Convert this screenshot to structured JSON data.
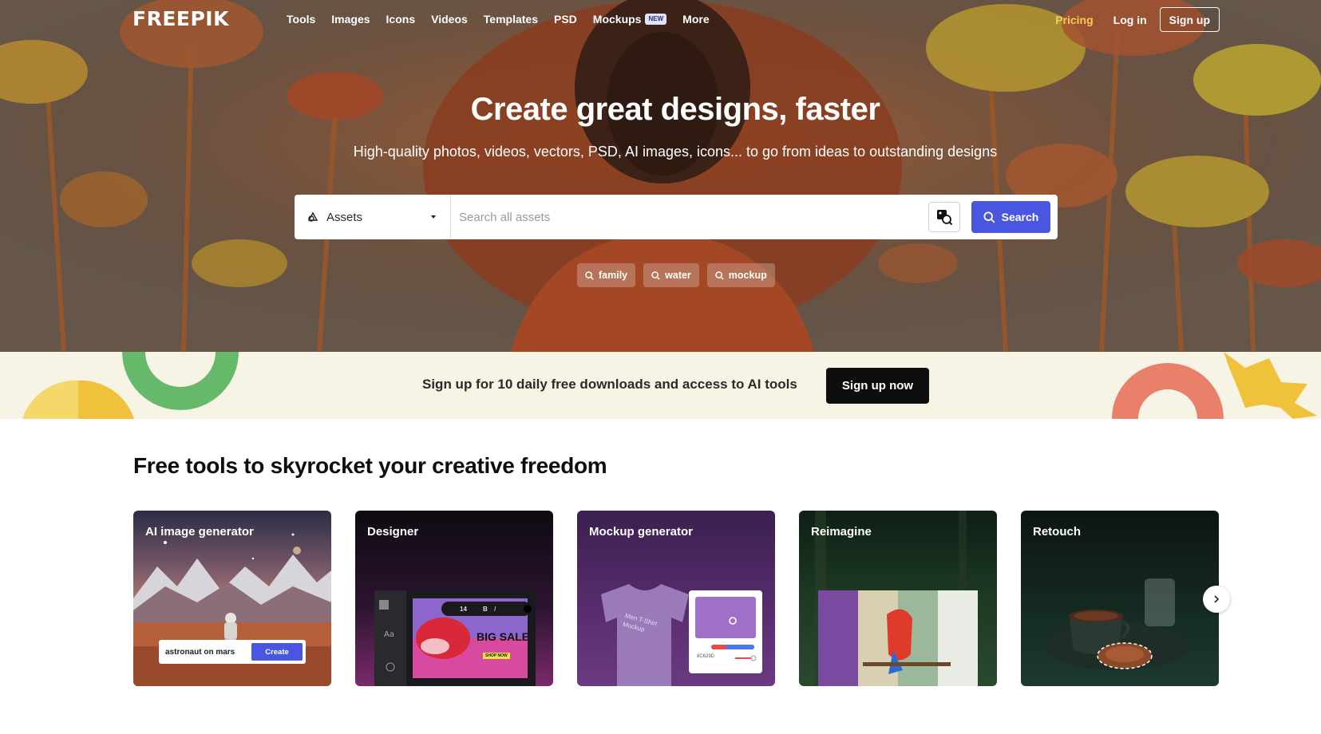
{
  "nav": {
    "logo": "FREEPIK",
    "links": [
      {
        "label": "Tools"
      },
      {
        "label": "Images"
      },
      {
        "label": "Icons"
      },
      {
        "label": "Videos"
      },
      {
        "label": "Templates"
      },
      {
        "label": "PSD"
      },
      {
        "label": "Mockups",
        "badge": "NEW"
      },
      {
        "label": "More"
      }
    ],
    "pricing": "Pricing",
    "login": "Log in",
    "signup": "Sign up"
  },
  "hero": {
    "title": "Create great designs, faster",
    "subtitle": "High-quality photos, videos, vectors, PSD, AI images, icons... to go from ideas to outstanding designs"
  },
  "search": {
    "asset_type": "Assets",
    "placeholder": "Search all assets",
    "button_label": "Search",
    "tags": [
      "family",
      "water",
      "mockup"
    ]
  },
  "banner": {
    "text": "Sign up for 10 daily free downloads and access to AI tools",
    "button": "Sign up now"
  },
  "tools": {
    "title": "Free tools to skyrocket your creative freedom",
    "cards": [
      {
        "label": "AI image generator",
        "prompt": "astronaut on mars",
        "action": "Create"
      },
      {
        "label": "Designer",
        "font_size": "14",
        "promo_text": "BIG SALE",
        "promo_small": "SHOP NOW"
      },
      {
        "label": "Mockup generator",
        "shirt_text": "Men T-Shirt Mockup",
        "hex": "8C629D"
      },
      {
        "label": "Reimagine"
      },
      {
        "label": "Retouch"
      }
    ]
  },
  "colors": {
    "brand_blue": "#4a55e0",
    "pricing_yellow": "#f2cf52",
    "banner_bg": "#f8f4e5",
    "dark": "#0e0e0e"
  },
  "icons": {
    "assets": "assets-icon",
    "search": "search-icon",
    "image_search": "image-search-icon",
    "next": "chevron-right-icon"
  }
}
